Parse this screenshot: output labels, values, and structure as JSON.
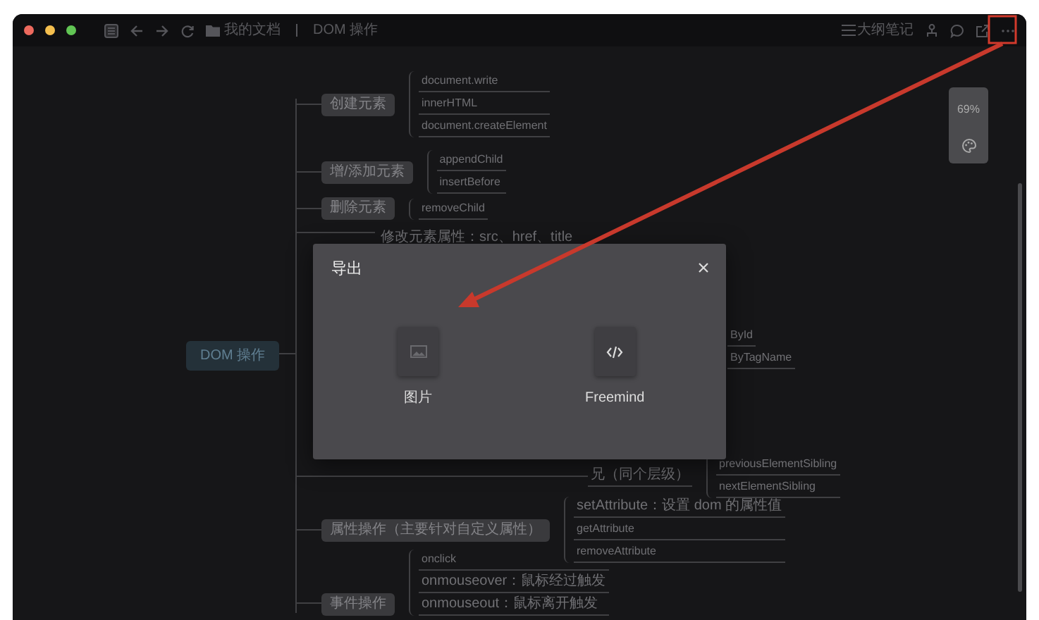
{
  "toolbar": {
    "breadcrumb": [
      "我的文档",
      "DOM 操作"
    ],
    "outline_label": "大纲笔记"
  },
  "mindmap": {
    "root": "DOM 操作",
    "branches": [
      {
        "label": "创建元素",
        "children": [
          {
            "label": "document.write"
          },
          {
            "label": "innerHTML"
          },
          {
            "label": "document.createElement"
          }
        ]
      },
      {
        "label": "增/添加元素",
        "children": [
          {
            "label": "appendChild"
          },
          {
            "label": "insertBefore"
          }
        ]
      },
      {
        "label": "删除元素",
        "children": [
          {
            "label": "removeChild"
          }
        ]
      },
      {
        "label": "属性操作（主要针对自定义属性）",
        "children": [
          {
            "label": "setAttribute：设置 dom 的属性值"
          },
          {
            "label": "getAttribute"
          },
          {
            "label": "removeAttribute"
          }
        ]
      },
      {
        "label": "事件操作",
        "children": [
          {
            "label": "onclick"
          },
          {
            "label": "onmouseover：鼠标经过触发"
          },
          {
            "label": "onmouseout：鼠标离开触发"
          }
        ]
      }
    ],
    "partly_hidden": [
      {
        "label": "修改元素属性：src、href、title"
      },
      {
        "label": "ById"
      },
      {
        "label": "ByTagName"
      },
      {
        "label": "兄（同个层级）",
        "children": [
          {
            "label": "previousElementSibling"
          },
          {
            "label": "nextElementSibling"
          }
        ]
      }
    ]
  },
  "zoom_panel": {
    "zoom": "69%"
  },
  "dialog": {
    "title": "导出",
    "options": [
      {
        "label": "图片",
        "kind": "image"
      },
      {
        "label": "Freemind",
        "kind": "code"
      }
    ]
  }
}
